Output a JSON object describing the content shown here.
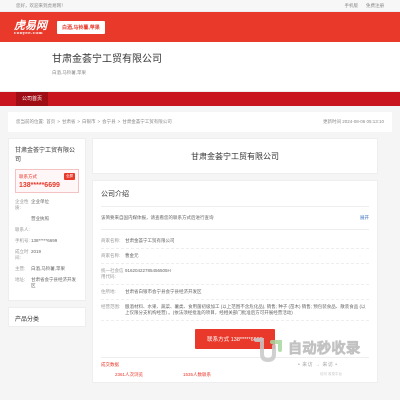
{
  "topbar": {
    "left": "您好，欢迎来到虎易网！",
    "links": [
      "手机版",
      "免费注册"
    ]
  },
  "brand": {
    "logo_cn": "虎易网",
    "logo_en": "cooyee.com",
    "tags": "白酒,马铃薯,苹果"
  },
  "header": {
    "title": "甘肃金荟宁工贸有限公司",
    "tags": "白酒,马铃薯,苹果"
  },
  "nav": {
    "home": "公司首页"
  },
  "breadcrumb": {
    "items": [
      "您当前的位置:",
      "首页",
      ">",
      "甘肃省",
      ">",
      "白银市",
      ">",
      "会宁县",
      ">",
      "甘肃金荟宁工贸有限公司"
    ],
    "updated": "更新时间 2024-08-06 05:13:10"
  },
  "side": {
    "company_name": "甘肃金荟宁工贸有限公司",
    "contact_label": "联系方式",
    "vip_badge": "全屏",
    "phone": "138*****6699",
    "info": [
      {
        "k": "企业性质:",
        "v": "企业单位"
      },
      {
        "k": "",
        "v": "营业执照"
      },
      {
        "k": "联系人:",
        "v": ""
      },
      {
        "k": "手机号:",
        "v": "138*****6699"
      },
      {
        "k": "成立时间:",
        "v": "2019"
      },
      {
        "k": "主营:",
        "v": "白酒,马铃薯,苹果"
      },
      {
        "k": "地址:",
        "v": "甘肃省会宁县经济开发区"
      }
    ],
    "products_title": "产品分类"
  },
  "main": {
    "title": "甘肃金荟宁工贸有限公司",
    "intro_title": "公司介绍",
    "intro_note": "该简要来自国内媒体报，请查看您的联系方式后进行查询",
    "intro_more": "展开",
    "rows": [
      {
        "k": "商家名称:",
        "v": "甘肃金荟宁工贸有限公司"
      },
      {
        "k": "商家名称:",
        "v": "曹金元"
      },
      {
        "k": "统一社会信用代码:",
        "v": "91620422785456505H"
      },
      {
        "k": "住所地:",
        "v": "甘肃省白银市会宁县会宁县经济开发区"
      },
      {
        "k": "经营范围:",
        "v": "酿酒材料、水果、蔬菜、薯类、食用菌初级加工 (以上范围不含危化品), 销售; 种子 (苗木) 销售; 预包装食品、散装食品 (以上仅限分支机构经营) 。(依法须经批准的项目，经相关部门批准后方可开展经营活动)"
      }
    ],
    "btn": "联系方式  138*****6699",
    "stats_label": "成交数据",
    "stats": [
      "2361人次浏览",
      "1535人数联系"
    ]
  },
  "watermark": {
    "main": "自动秒收录",
    "sub": "•  来访  →  来访  •",
    "small": "访问 收录平台"
  }
}
